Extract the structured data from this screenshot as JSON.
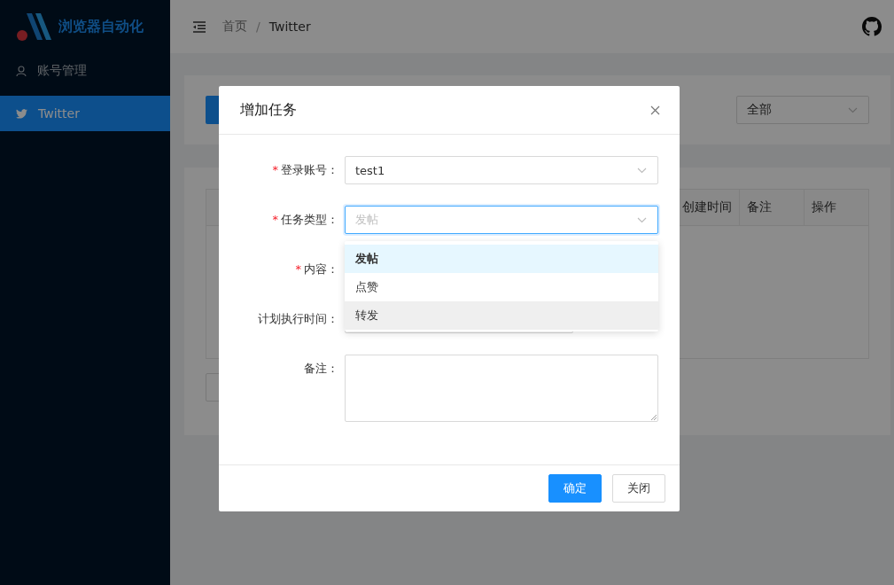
{
  "app": {
    "title": "浏览器自动化"
  },
  "sidebar": {
    "items": [
      {
        "label": "账号管理",
        "selected": false
      },
      {
        "label": "Twitter",
        "selected": true
      }
    ]
  },
  "breadcrumb": {
    "items": [
      "首页",
      "Twitter"
    ],
    "separator": "/"
  },
  "filter": {
    "value": "全部"
  },
  "table": {
    "columns": [
      "创建时间",
      "备注",
      "操作"
    ]
  },
  "dialog": {
    "title": "增加任务",
    "fields": [
      {
        "mark": "*",
        "label": "登录账号：",
        "kind": "select",
        "value": "test1",
        "focused": false
      },
      {
        "mark": "*",
        "label": "任务类型：",
        "kind": "select",
        "placeholder": "发帖",
        "focused": true
      },
      {
        "mark": "*",
        "label": "内容：",
        "kind": "covered"
      },
      {
        "label": "计划执行时间：",
        "kind": "date"
      },
      {
        "label": "备注：",
        "kind": "textarea"
      }
    ],
    "dropdown": [
      {
        "label": "发帖",
        "selected": true,
        "hovered": false
      },
      {
        "label": "点赞",
        "selected": false,
        "hovered": false
      },
      {
        "label": "转发",
        "selected": false,
        "hovered": true
      }
    ],
    "buttons": [
      {
        "label": "确定",
        "kind": "primary"
      },
      {
        "label": "关闭",
        "kind": "default"
      }
    ]
  }
}
